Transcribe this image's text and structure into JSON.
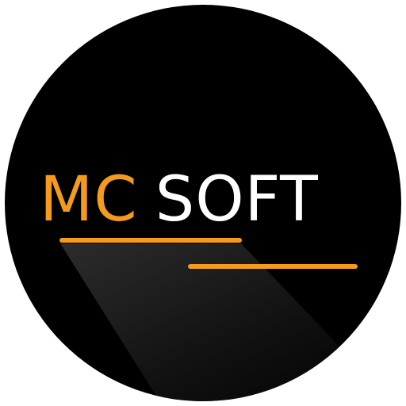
{
  "logo": {
    "part1": "MC",
    "part2": "SOFT"
  },
  "colors": {
    "background": "#000000",
    "accent": "#f39a1f",
    "text": "#ffffff",
    "shadow": "#2a2a2a"
  }
}
